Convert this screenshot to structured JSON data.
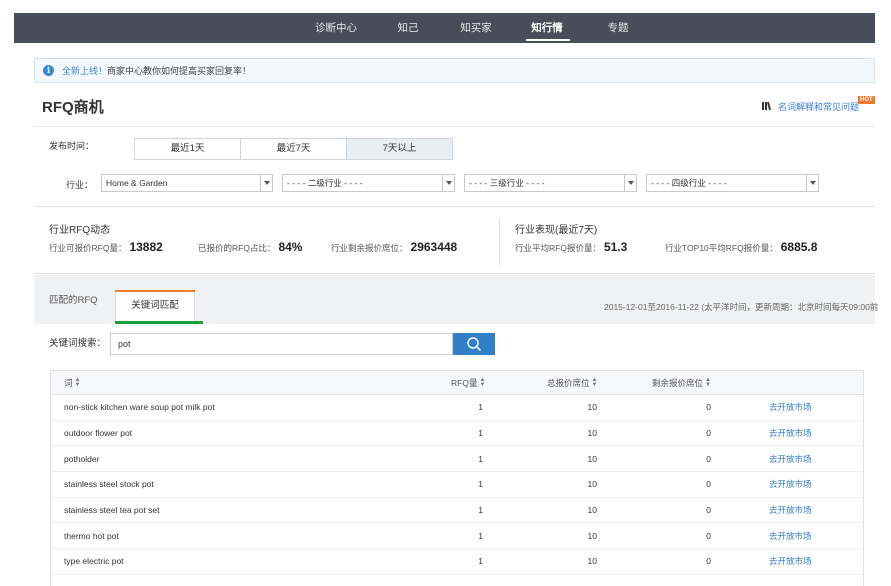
{
  "nav": {
    "items": [
      {
        "label": "诊断中心",
        "active": false
      },
      {
        "label": "知己",
        "active": false
      },
      {
        "label": "知买家",
        "active": false
      },
      {
        "label": "知行情",
        "active": true
      },
      {
        "label": "专题",
        "active": false
      }
    ]
  },
  "notice": {
    "link": "全新上线！",
    "text": "商家中心教你如何提高买家回复率！"
  },
  "page": {
    "title": "RFQ商机",
    "help_link": "名词解释和常见问题",
    "hot_badge": "HOT"
  },
  "filters": {
    "time_label": "发布时间：",
    "time_options": [
      "最近1天",
      "最近7天",
      "7天以上"
    ],
    "time_selected": "7天以上",
    "industry_label": "行业：",
    "dropdowns": [
      "Home & Garden",
      "- - - - 二级行业 - - - -",
      "- - - - 三级行业 - - - -",
      "- - - - 四级行业 - - - -"
    ]
  },
  "stats": {
    "left_title": "行业RFQ动态",
    "left": [
      {
        "label": "行业可报价RFQ量：",
        "value": "13882"
      },
      {
        "label": "已报价的RFQ占比：",
        "value": "84%"
      },
      {
        "label": "行业剩余报价席位：",
        "value": "2963448"
      }
    ],
    "right_title": "行业表现(最近7天)",
    "right": [
      {
        "label": "行业平均RFQ报价量：",
        "value": "51.3"
      },
      {
        "label": "行业TOP10平均RFQ报价量：",
        "value": "6885.8"
      }
    ]
  },
  "tabs": {
    "items": [
      "匹配的RFQ",
      "关键词匹配"
    ],
    "active": "关键词匹配",
    "date_range": "2015-12-01至2016-11-22 (太平洋时间，更新周期：北京时间每天09:00前"
  },
  "search": {
    "label": "关键词搜索：",
    "value": "pot",
    "icon": "search-icon"
  },
  "table": {
    "headers": [
      "词",
      "RFQ量",
      "总报价席位",
      "剩余报价席位"
    ],
    "rows": [
      {
        "word": "non-stick kitchen ware soup pot milk pot",
        "rfq": "1",
        "total": "10",
        "remain": "0",
        "link": "去开放市场"
      },
      {
        "word": "outdoor flower pot",
        "rfq": "1",
        "total": "10",
        "remain": "0",
        "link": "去开放市场"
      },
      {
        "word": "potholder",
        "rfq": "1",
        "total": "10",
        "remain": "0",
        "link": "去开放市场"
      },
      {
        "word": "stainless steel stock pot",
        "rfq": "1",
        "total": "10",
        "remain": "0",
        "link": "去开放市场"
      },
      {
        "word": "stainless steel tea pot set",
        "rfq": "1",
        "total": "10",
        "remain": "0",
        "link": "去开放市场"
      },
      {
        "word": "thermo hot pot",
        "rfq": "1",
        "total": "10",
        "remain": "0",
        "link": "去开放市场"
      },
      {
        "word": "type electric pot",
        "rfq": "1",
        "total": "10",
        "remain": "0",
        "link": "去开放市场"
      }
    ]
  },
  "colors": {
    "nav_bg": "#474d59",
    "link_blue": "#2f7cc8",
    "search_button": "#2f80c6",
    "tab_accent_orange": "#f07a2e",
    "tab_underline_green": "#1a9f3a"
  }
}
